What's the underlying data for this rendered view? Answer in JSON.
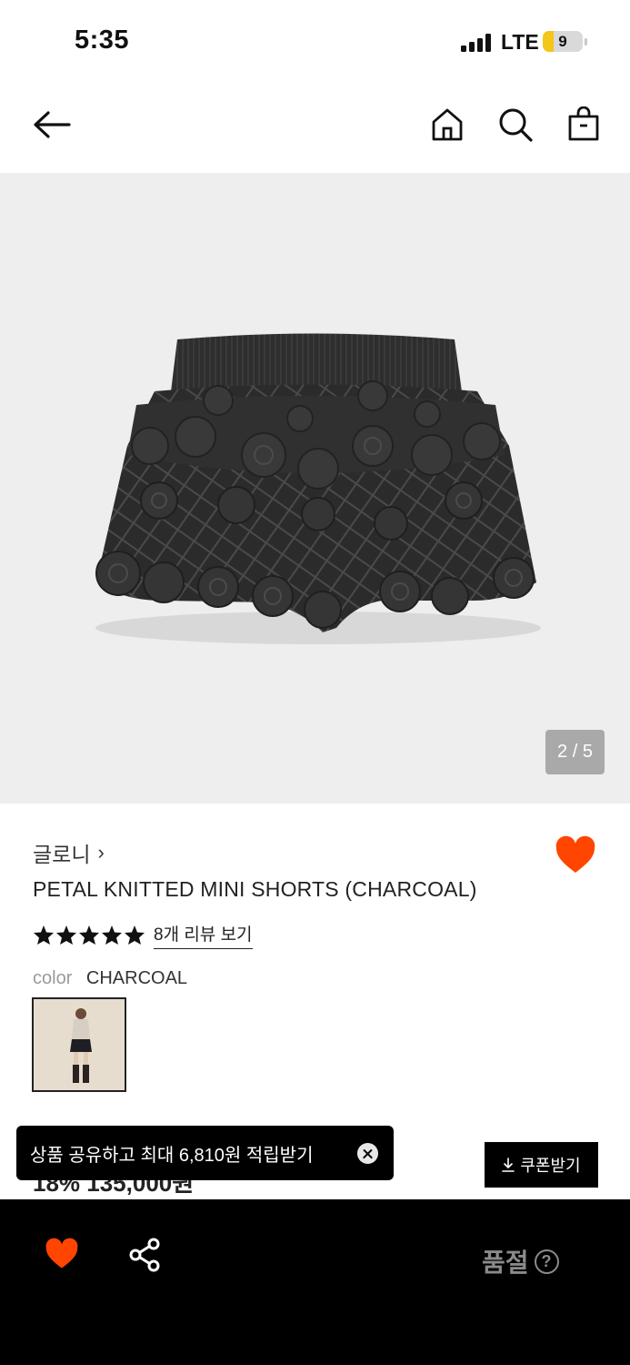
{
  "status_bar": {
    "time": "5:35",
    "network": "LTE",
    "battery": "9"
  },
  "nav": {
    "back_icon": "arrow-left-icon",
    "home_icon": "home-icon",
    "search_icon": "search-icon",
    "bag_icon": "shopping-bag-icon"
  },
  "gallery": {
    "counter": "2 / 5",
    "image_subject": "charcoal crochet knitted mini shorts with petal flowers"
  },
  "product": {
    "brand": "글로니",
    "brand_chevron": "›",
    "title": "PETAL KNITTED MINI SHORTS (CHARCOAL)",
    "rating_stars": 5,
    "review_link": "8개 리뷰 보기",
    "color_label": "color",
    "color_value": "CHARCOAL",
    "price_partial": "18% 135,000원",
    "wishlisted": true
  },
  "toast": {
    "message": "상품 공유하고 최대 6,810원 적립받기"
  },
  "coupon": {
    "label": "쿠폰받기",
    "icon": "download-icon"
  },
  "bottom_bar": {
    "heart_icon": "heart-icon",
    "share_icon": "share-icon",
    "status": "품절",
    "help": "?"
  },
  "colors": {
    "accent": "#ff4500",
    "black": "#000000",
    "gallery_bg": "#eeeeee",
    "muted": "#8a8a8a"
  }
}
